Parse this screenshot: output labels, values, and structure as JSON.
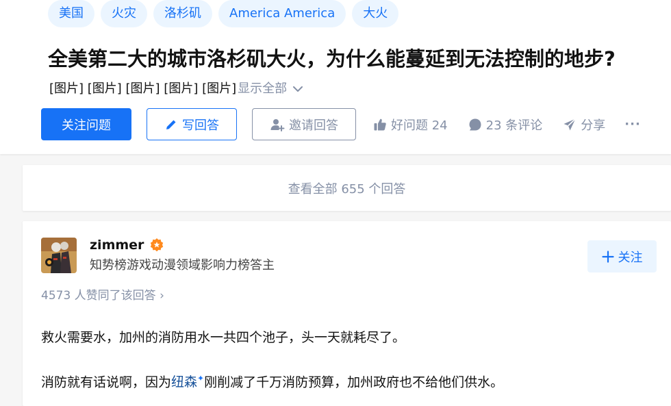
{
  "topics": [
    "美国",
    "火灾",
    "洛杉矶",
    "America America",
    "大火"
  ],
  "question": {
    "title": "全美第二大的城市洛杉矶大火，为什么能蔓延到无法控制的地步?",
    "detail": "[图片] [图片] [图片] [图片] [图片]",
    "show_all": "显示全部"
  },
  "actions": {
    "follow_question": "关注问题",
    "write_answer": "写回答",
    "invite_answer": "邀请回答",
    "good_question": "好问题 24",
    "comments": "23 条评论",
    "share": "分享",
    "more": "···"
  },
  "view_all_answers": "查看全部 655 个回答",
  "answer": {
    "author": {
      "name": "zimmer",
      "bio": "知势榜游戏动漫领域影响力榜答主"
    },
    "follow_label": "关注",
    "votes": "4573 人赞同了该回答 ›",
    "paragraph1": "救火需要水，加州的消防用水一共四个池子，头一天就耗尽了。",
    "paragraph2_before": "消防就有话说啊，因为",
    "paragraph2_link": "纽森",
    "paragraph2_after": "刚削减了千万消防预算，加州政府也不给他们供水。"
  },
  "colors": {
    "brand_blue": "#1772f6",
    "light_blue_bg": "#ebf5ff",
    "muted_gray": "#8590a6",
    "badge_orange": "#ff8a1e"
  },
  "icons": [
    "chevron-down-icon",
    "pencil-icon",
    "invite-user-icon",
    "thumb-up-icon",
    "comment-icon",
    "share-icon",
    "more-icon",
    "verified-badge-icon",
    "plus-icon"
  ]
}
